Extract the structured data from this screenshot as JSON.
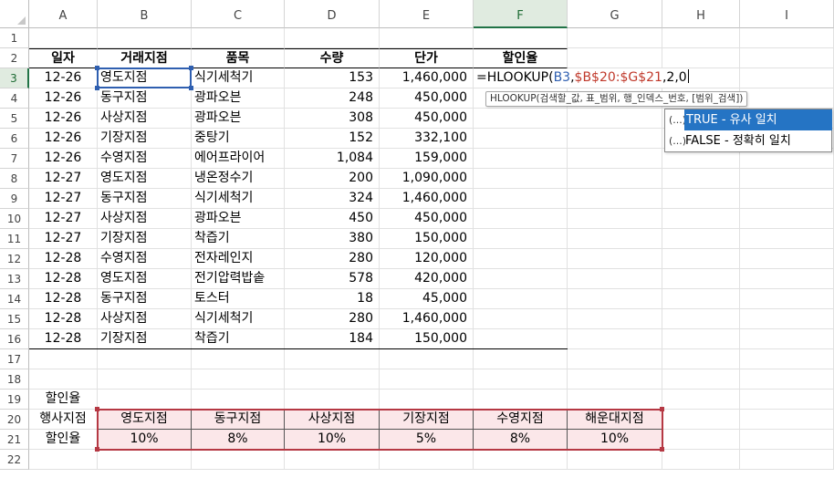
{
  "columns": [
    "A",
    "B",
    "C",
    "D",
    "E",
    "F",
    "G",
    "H",
    "I"
  ],
  "rows": [
    "1",
    "2",
    "3",
    "4",
    "5",
    "6",
    "7",
    "8",
    "9",
    "10",
    "11",
    "12",
    "13",
    "14",
    "15",
    "16",
    "17",
    "18",
    "19",
    "20",
    "21",
    "22"
  ],
  "headers": {
    "date": "일자",
    "branch": "거래지점",
    "item": "품목",
    "qty": "수량",
    "price": "단가",
    "discount": "할인율"
  },
  "data_rows": [
    {
      "date": "12-26",
      "branch": "영도지점",
      "item": "식기세척기",
      "qty": "153",
      "price": "1,460,000"
    },
    {
      "date": "12-26",
      "branch": "동구지점",
      "item": "광파오븐",
      "qty": "248",
      "price": "450,000"
    },
    {
      "date": "12-26",
      "branch": "사상지점",
      "item": "광파오븐",
      "qty": "308",
      "price": "450,000"
    },
    {
      "date": "12-26",
      "branch": "기장지점",
      "item": "중탕기",
      "qty": "152",
      "price": "332,100"
    },
    {
      "date": "12-26",
      "branch": "수영지점",
      "item": "에어프라이어",
      "qty": "1,084",
      "price": "159,000"
    },
    {
      "date": "12-27",
      "branch": "영도지점",
      "item": "냉온정수기",
      "qty": "200",
      "price": "1,090,000"
    },
    {
      "date": "12-27",
      "branch": "동구지점",
      "item": "식기세척기",
      "qty": "324",
      "price": "1,460,000"
    },
    {
      "date": "12-27",
      "branch": "사상지점",
      "item": "광파오븐",
      "qty": "450",
      "price": "450,000"
    },
    {
      "date": "12-27",
      "branch": "기장지점",
      "item": "착즙기",
      "qty": "380",
      "price": "150,000"
    },
    {
      "date": "12-28",
      "branch": "수영지점",
      "item": "전자레인지",
      "qty": "280",
      "price": "120,000"
    },
    {
      "date": "12-28",
      "branch": "영도지점",
      "item": "전기압력밥솥",
      "qty": "578",
      "price": "420,000"
    },
    {
      "date": "12-28",
      "branch": "동구지점",
      "item": "토스터",
      "qty": "18",
      "price": "45,000"
    },
    {
      "date": "12-28",
      "branch": "사상지점",
      "item": "식기세척기",
      "qty": "280",
      "price": "1,460,000"
    },
    {
      "date": "12-28",
      "branch": "기장지점",
      "item": "착즙기",
      "qty": "184",
      "price": "150,000"
    }
  ],
  "formula": {
    "prefix": "=HLOOKUP(",
    "ref1": "B3",
    "sep1": ",",
    "ref2": "$B$20:$G$21",
    "rest": ",2,0"
  },
  "tooltip": "HLOOKUP(검색할_값, 표_범위, 행_인덱스_번호, [범위_검색])",
  "autocomplete": [
    {
      "icon": "(...)",
      "label": "TRUE - 유사 일치",
      "selected": true
    },
    {
      "icon": "(...)",
      "label": "FALSE - 정확히 일치",
      "selected": false
    }
  ],
  "discount_table": {
    "title": "할인율",
    "row_label_1": "행사지점",
    "row_label_2": "할인율",
    "branches": [
      "영도지점",
      "동구지점",
      "사상지점",
      "기장지점",
      "수영지점",
      "해운대지점"
    ],
    "rates": [
      "10%",
      "8%",
      "10%",
      "5%",
      "8%",
      "10%"
    ]
  },
  "active_cell": "F3"
}
